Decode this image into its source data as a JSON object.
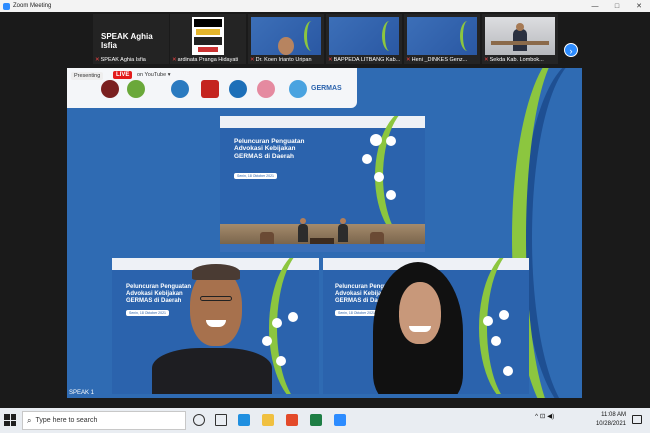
{
  "window": {
    "title": "Zoom Meeting",
    "controls": [
      "—",
      "□",
      "✕"
    ]
  },
  "strip": {
    "active_speaker": "SPEAK Aghia Isfia",
    "thumbnails": [
      {
        "name": "SPEAK Aghia Isfia"
      },
      {
        "name": "ardinata Pranga Hidayati"
      },
      {
        "name": "Dr. Koen Irianto Uripan"
      },
      {
        "name": "BAPPEDA LITBANG Kab..."
      },
      {
        "name": "Heni _DINKES Genz..."
      },
      {
        "name": "Sekda Kab. Lombok..."
      }
    ],
    "next_icon": "›"
  },
  "share": {
    "presenter_badge": "Presenting",
    "live_label": "LIVE",
    "youtube_label": "on YouTube ▾",
    "slide_title": "Peluncuran Penguatan Advokasi Kebijakan GERMAS di Daerah",
    "slide_date": "Senin, 18 Oktober 2021",
    "germas_label": "GERMAS",
    "self_label": "SPEAK 1"
  },
  "taskbar": {
    "search_placeholder": "Type here to search",
    "time": "11:08 AM",
    "date": "10/28/2021",
    "tray": "^  ⊡  ◀)"
  },
  "colors": {
    "zoom_blue": "#2d8cff",
    "germas_green": "#8cc63f",
    "slide_blue": "#2b63ad"
  }
}
